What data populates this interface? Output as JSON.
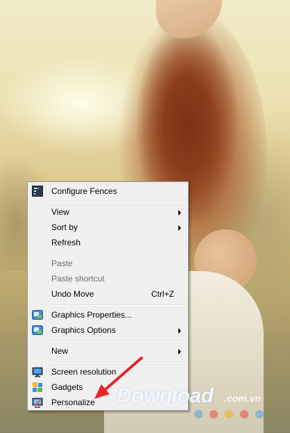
{
  "menu": {
    "items": [
      {
        "label": "Configure Fences",
        "icon": "fences-icon",
        "enabled": true
      },
      {
        "label": "View",
        "submenu": true,
        "enabled": true
      },
      {
        "label": "Sort by",
        "submenu": true,
        "enabled": true
      },
      {
        "label": "Refresh",
        "enabled": true
      },
      {
        "label": "Paste",
        "enabled": false
      },
      {
        "label": "Paste shortcut",
        "enabled": false
      },
      {
        "label": "Undo Move",
        "shortcut": "Ctrl+Z",
        "enabled": true
      },
      {
        "label": "Graphics Properties...",
        "icon": "intel-graphics-icon",
        "enabled": true
      },
      {
        "label": "Graphics Options",
        "icon": "intel-graphics-icon",
        "submenu": true,
        "enabled": true
      },
      {
        "label": "New",
        "submenu": true,
        "enabled": true
      },
      {
        "label": "Screen resolution",
        "icon": "monitor-icon",
        "enabled": true
      },
      {
        "label": "Gadgets",
        "icon": "gadgets-icon",
        "enabled": true
      },
      {
        "label": "Personalize",
        "icon": "personalize-icon",
        "enabled": true
      }
    ]
  },
  "annotation": {
    "color": "#e8242a"
  },
  "watermark": {
    "text": "Download",
    "suffix": ".com.vn",
    "dot_colors": [
      "#4da3d6",
      "#e94a3e",
      "#f2b01e",
      "#e94a3e",
      "#4da3d6"
    ]
  }
}
